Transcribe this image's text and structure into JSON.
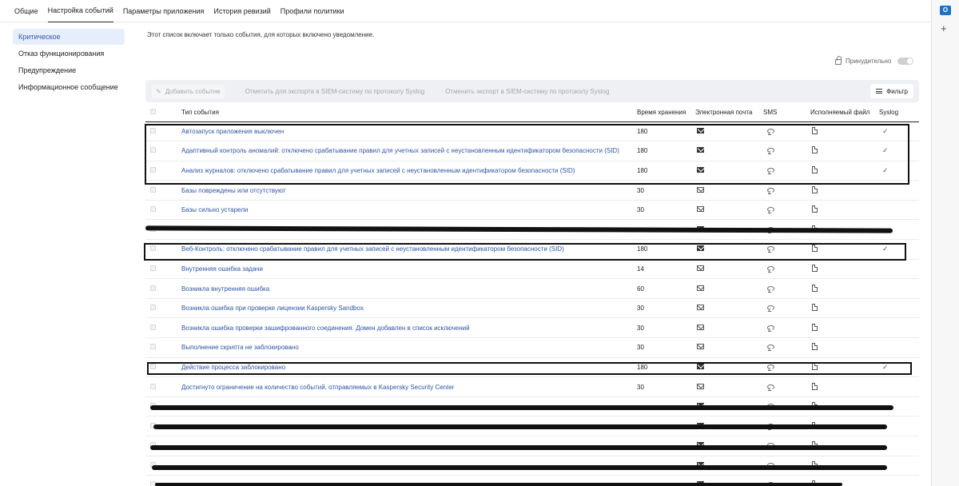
{
  "tabs": [
    "Общие",
    "Настройка событий",
    "Параметры приложения",
    "История ревизий",
    "Профили политики"
  ],
  "sidebar": {
    "items": [
      "Критическое",
      "Отказ функционирования",
      "Предупреждение",
      "Информационное сообщение"
    ]
  },
  "main": {
    "note": "Этот список включает только события, для которых включено уведомление.",
    "enforce_label": "Принудительно"
  },
  "toolbar": {
    "add_label": "Добавить событие",
    "mark_label": "Отметить для экспорта в SIEM-систему по протоколу Syslog",
    "unmark_label": "Отменить экспорт в SIEM-систему по протоколу Syslog",
    "filter_label": "Фильтр"
  },
  "table": {
    "columns": [
      "Тип события",
      "Время хранения",
      "Электронная почта",
      "SMS",
      "Исполняемый файл",
      "Syslog"
    ],
    "rows": [
      {
        "name": "Автозапуск приложения выключен",
        "storage": "180",
        "email": "filled",
        "syslog": "✓"
      },
      {
        "name": "Адаптивный контроль аномалий: отключено срабатывание правил для учетных записей с неустановленным идентификатором безопасности (SID)",
        "storage": "180",
        "email": "filled",
        "syslog": "✓"
      },
      {
        "name": "Анализ журналов: отключено срабатывание правил для учетных записей с неустановленным идентификатором безопасности (SID)",
        "storage": "180",
        "email": "filled",
        "syslog": "✓"
      },
      {
        "name": "Базы повреждены или отсутствуют",
        "storage": "30",
        "email": "outline",
        "syslog": ""
      },
      {
        "name": "Базы сильно устарели",
        "storage": "30",
        "email": "outline",
        "syslog": ""
      },
      {
        "name": "",
        "storage": "",
        "email": "filled",
        "syslog": ""
      },
      {
        "name": "Веб-Контроль: отключено срабатывание правил для учетных записей с неустановленным идентификатором безопасности (SID)",
        "storage": "180",
        "email": "filled",
        "syslog": "✓"
      },
      {
        "name": "Внутренняя ошибка задачи",
        "storage": "14",
        "email": "outline",
        "syslog": ""
      },
      {
        "name": "Возникла внутренняя ошибка",
        "storage": "60",
        "email": "outline",
        "syslog": ""
      },
      {
        "name": "Возникла ошибка при проверке лицензии Kaspersky Sandbox",
        "storage": "30",
        "email": "outline",
        "syslog": ""
      },
      {
        "name": "Возникла ошибка проверки зашифрованного соединения. Домен добавлен в список исключений",
        "storage": "30",
        "email": "outline",
        "syslog": ""
      },
      {
        "name": "Выполнение скрипта не заблокировано",
        "storage": "30",
        "email": "outline",
        "syslog": ""
      },
      {
        "name": "Действие процесса заблокировано",
        "storage": "180",
        "email": "filled",
        "syslog": "✓"
      },
      {
        "name": "Достигнуто ограничение на количество событий, отправляемых в Kaspersky Security Center",
        "storage": "30",
        "email": "outline",
        "syslog": ""
      },
      {
        "name": "",
        "storage": "",
        "email": "filled",
        "syslog": ""
      },
      {
        "name": "",
        "storage": "",
        "email": "filled",
        "syslog": ""
      },
      {
        "name": "",
        "storage": "",
        "email": "filled",
        "syslog": ""
      },
      {
        "name": "",
        "storage": "",
        "email": "filled",
        "syslog": ""
      },
      {
        "name": "",
        "storage": "",
        "email": "filled",
        "syslog": ""
      }
    ]
  },
  "colors": {
    "link": "#2f55a4",
    "active_bg": "#e6eefc"
  },
  "icons": [
    "lock-icon",
    "pencil-icon",
    "filter-icon",
    "mail-icon",
    "sms-icon",
    "file-icon",
    "check-icon",
    "outlook-icon",
    "plus-icon"
  ]
}
